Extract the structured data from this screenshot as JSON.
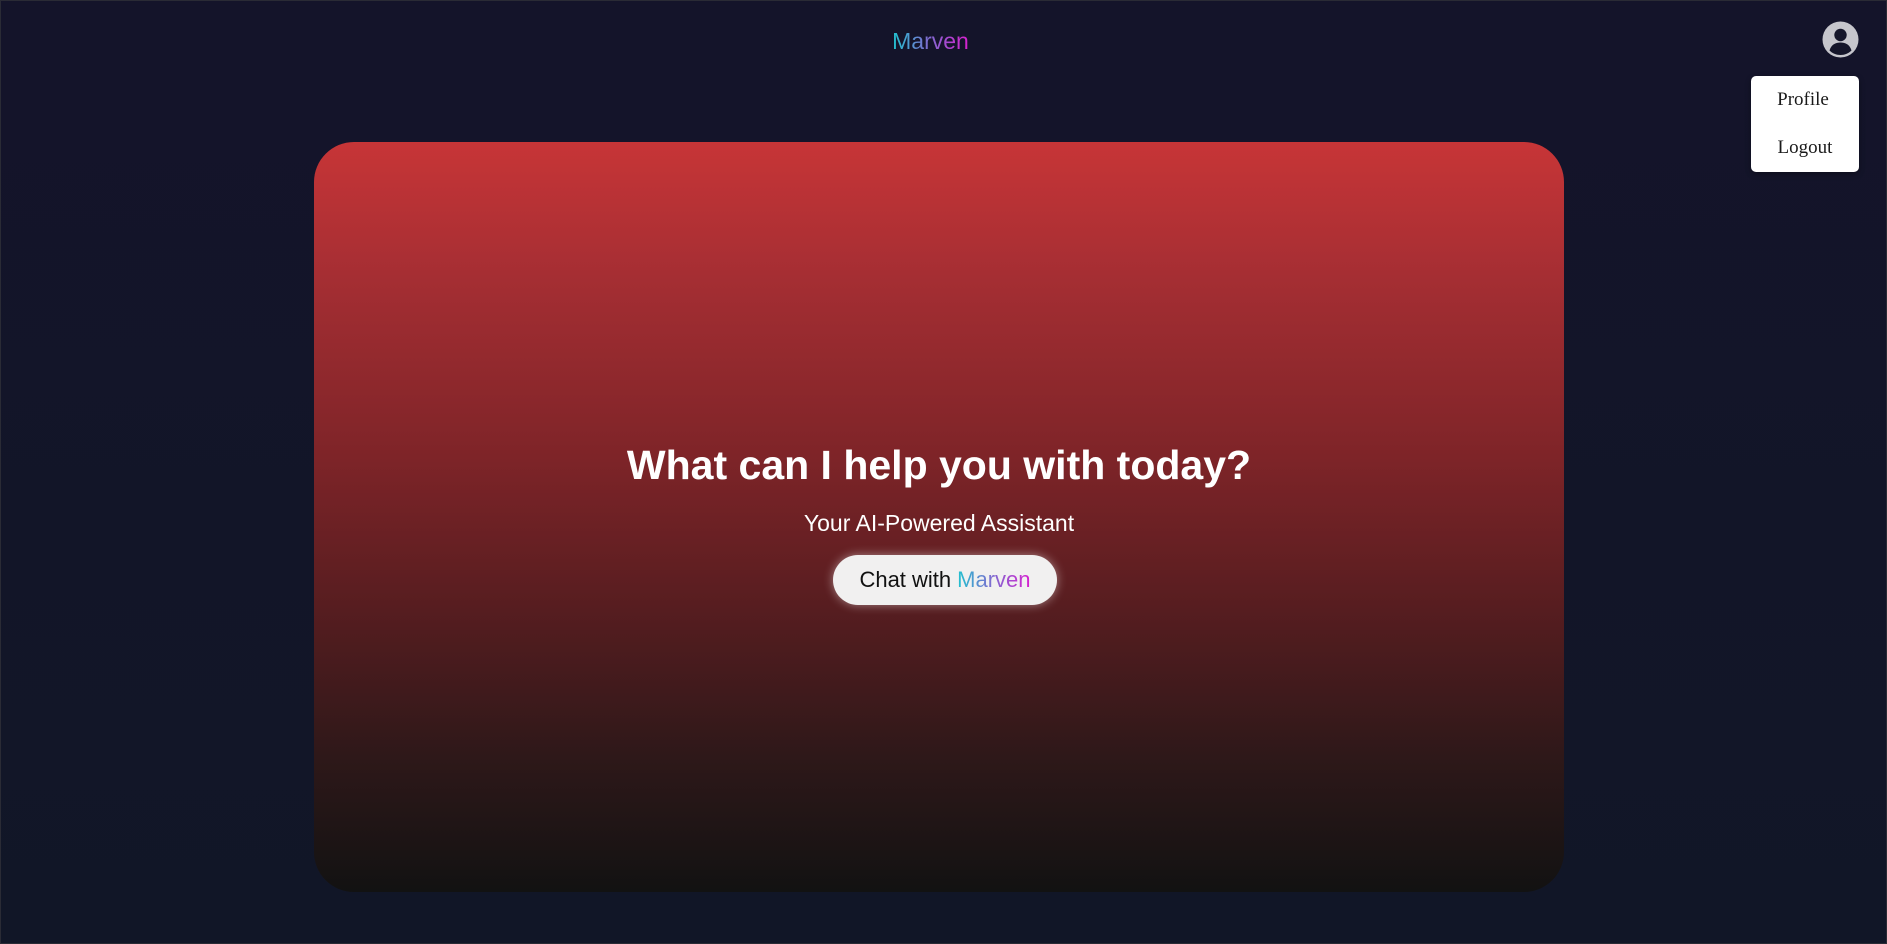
{
  "header": {
    "brand": "Marven"
  },
  "user_menu": {
    "avatar_icon": "user-circle-icon",
    "items": [
      {
        "label": "Profile"
      },
      {
        "label": "Logout"
      }
    ]
  },
  "hero": {
    "title": "What can I help you with today?",
    "subtitle": "Your AI-Powered Assistant",
    "cta_prefix": "Chat with",
    "cta_brand": "Marven"
  },
  "colors": {
    "background": "#121326",
    "hero_top": "#c73537",
    "hero_bottom": "#121212",
    "brand_gradient_start": "#1fc3cf",
    "brand_gradient_end": "#d81fd0",
    "avatar": "#c6c6cc"
  }
}
